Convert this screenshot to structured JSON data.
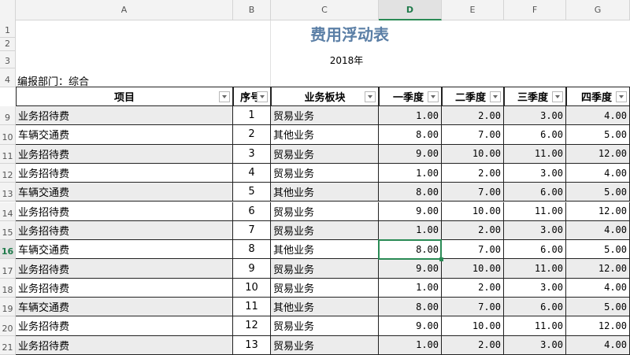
{
  "columns": [
    "A",
    "B",
    "C",
    "D",
    "E",
    "F",
    "G"
  ],
  "active_column": "D",
  "row_headers": [
    "1",
    "2",
    "3",
    "4",
    "9",
    "10",
    "11",
    "12",
    "13",
    "14",
    "15",
    "16",
    "17",
    "18",
    "19",
    "20",
    "21"
  ],
  "active_row": "16",
  "sheet": {
    "title": "费用浮动表",
    "year": "2018年",
    "department": "编报部门：综合"
  },
  "table": {
    "headers": [
      "项目",
      "序号",
      "业务板块",
      "一季度",
      "二季度",
      "三季度",
      "四季度"
    ],
    "header_seq_display": "序号",
    "rows": [
      [
        "业务招待费",
        "1",
        "贸易业务",
        "1.00",
        "2.00",
        "3.00",
        "4.00"
      ],
      [
        "车辆交通费",
        "2",
        "其他业务",
        "8.00",
        "7.00",
        "6.00",
        "5.00"
      ],
      [
        "业务招待费",
        "3",
        "贸易业务",
        "9.00",
        "10.00",
        "11.00",
        "12.00"
      ],
      [
        "业务招待费",
        "4",
        "贸易业务",
        "1.00",
        "2.00",
        "3.00",
        "4.00"
      ],
      [
        "车辆交通费",
        "5",
        "其他业务",
        "8.00",
        "7.00",
        "6.00",
        "5.00"
      ],
      [
        "业务招待费",
        "6",
        "贸易业务",
        "9.00",
        "10.00",
        "11.00",
        "12.00"
      ],
      [
        "业务招待费",
        "7",
        "贸易业务",
        "1.00",
        "2.00",
        "3.00",
        "4.00"
      ],
      [
        "车辆交通费",
        "8",
        "其他业务",
        "8.00",
        "7.00",
        "6.00",
        "5.00"
      ],
      [
        "业务招待费",
        "9",
        "贸易业务",
        "9.00",
        "10.00",
        "11.00",
        "12.00"
      ],
      [
        "业务招待费",
        "10",
        "贸易业务",
        "1.00",
        "2.00",
        "3.00",
        "4.00"
      ],
      [
        "车辆交通费",
        "11",
        "其他业务",
        "8.00",
        "7.00",
        "6.00",
        "5.00"
      ],
      [
        "业务招待费",
        "12",
        "贸易业务",
        "9.00",
        "10.00",
        "11.00",
        "12.00"
      ],
      [
        "业务招待费",
        "13",
        "贸易业务",
        "1.00",
        "2.00",
        "3.00",
        "4.00"
      ]
    ],
    "selected_cell": "D16"
  },
  "colors": {
    "accent": "#2a8a55",
    "title": "#5b7fa6",
    "row_shade": "#ececec"
  }
}
